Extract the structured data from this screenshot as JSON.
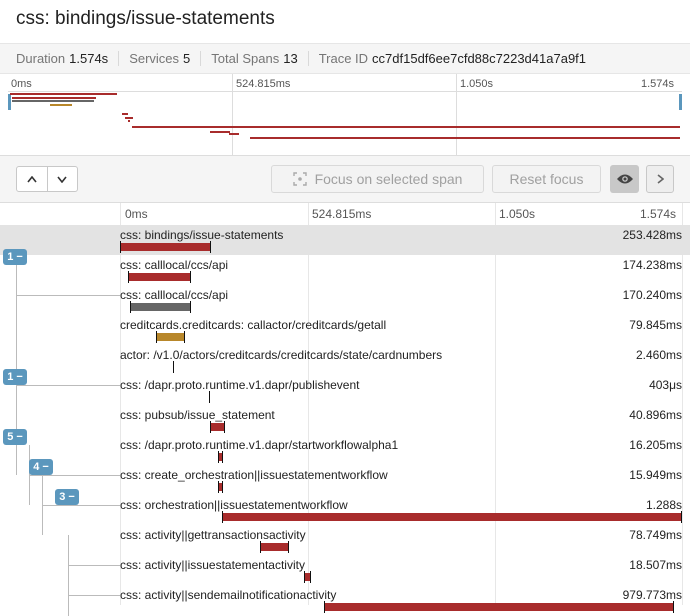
{
  "header": {
    "title": "css: bindings/issue-statements"
  },
  "stats": [
    {
      "label": "Duration",
      "value": "1.574s"
    },
    {
      "label": "Services",
      "value": "5"
    },
    {
      "label": "Total Spans",
      "value": "13"
    },
    {
      "label": "Trace ID",
      "value": "cc7df15df6ee7cfd88c7223d41a7a9f1"
    }
  ],
  "minimap": {
    "ticks": [
      "0ms",
      "524.815ms",
      "1.050s",
      "1.574s"
    ]
  },
  "toolbar": {
    "up_label": "⌃",
    "down_label": "⌄",
    "focus_label": "Focus on selected span",
    "reset_label": "Reset focus",
    "next_label": "›"
  },
  "timeline": {
    "ticks": [
      "0ms",
      "524.815ms",
      "1.050s",
      "1.574s"
    ]
  },
  "colors": {
    "red": "#a82c2c",
    "gray": "#666666",
    "gold": "#b8872a",
    "badge": "#5b97bd"
  },
  "badges": [
    "1 −",
    "1 −",
    "5 −",
    "4 −",
    "3 −"
  ],
  "spans": [
    {
      "name": "css: bindings/issue-statements",
      "duration": "253.428ms",
      "color": "red",
      "selected": true
    },
    {
      "name": "css: calllocal/ccs/api",
      "duration": "174.238ms",
      "color": "red"
    },
    {
      "name": "css: calllocal/ccs/api",
      "duration": "170.240ms",
      "color": "gray"
    },
    {
      "name": "creditcards.creditcards: callactor/creditcards/getall",
      "duration": "79.845ms",
      "color": "gold"
    },
    {
      "name": "actor: /v1.0/actors/creditcards/creditcards/state/cardnumbers",
      "duration": "2.460ms",
      "color": "gold"
    },
    {
      "name": "css: /dapr.proto.runtime.v1.dapr/publishevent",
      "duration": "403μs",
      "color": "red"
    },
    {
      "name": "css: pubsub/issue_statement",
      "duration": "40.896ms",
      "color": "red"
    },
    {
      "name": "css: /dapr.proto.runtime.v1.dapr/startworkflowalpha1",
      "duration": "16.205ms",
      "color": "red"
    },
    {
      "name": "css: create_orchestration||issuestatementworkflow",
      "duration": "15.949ms",
      "color": "red"
    },
    {
      "name": "css: orchestration||issuestatementworkflow",
      "duration": "1.288s",
      "color": "red"
    },
    {
      "name": "css: activity||gettransactionsactivity",
      "duration": "78.749ms",
      "color": "red"
    },
    {
      "name": "css: activity||issuestatementactivity",
      "duration": "18.507ms",
      "color": "red"
    },
    {
      "name": "css: activity||sendemailnotificationactivity",
      "duration": "979.773ms",
      "color": "red"
    }
  ]
}
